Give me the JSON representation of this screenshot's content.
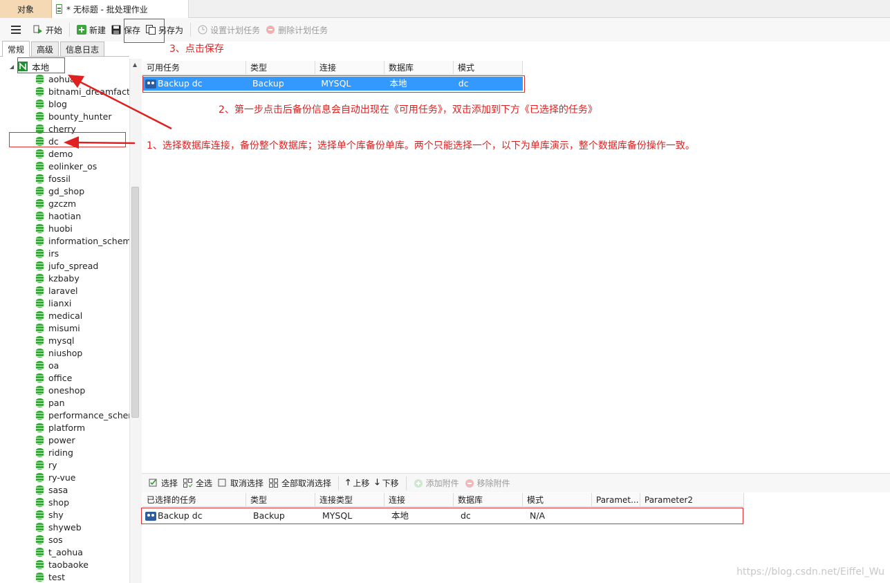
{
  "tabs": {
    "objects": "对象",
    "document": "* 无标题 - 批处理作业"
  },
  "toolbar": {
    "start": "开始",
    "new": "新建",
    "save": "保存",
    "save_as": "另存为",
    "set_schedule": "设置计划任务",
    "delete_schedule": "删除计划任务"
  },
  "left_tabs": [
    "常规",
    "高级",
    "信息日志"
  ],
  "tree": {
    "root": "本地",
    "databases": [
      "aohua",
      "bitnami_dreamfacto",
      "blog",
      "bounty_hunter",
      "cherry",
      "dc",
      "demo",
      "eolinker_os",
      "fossil",
      "gd_shop",
      "gzczm",
      "haotian",
      "huobi",
      "information_schema",
      "irs",
      "jufo_spread",
      "kzbaby",
      "laravel",
      "lianxi",
      "medical",
      "misumi",
      "mysql",
      "niushop",
      "oa",
      "office",
      "oneshop",
      "pan",
      "performance_schem",
      "platform",
      "power",
      "riding",
      "ry",
      "ry-vue",
      "sasa",
      "shop",
      "shy",
      "shyweb",
      "sos",
      "t_aohua",
      "taobaoke",
      "test"
    ]
  },
  "available": {
    "headers": [
      "可用任务",
      "类型",
      "连接",
      "数据库",
      "模式"
    ],
    "rows": [
      [
        "Backup dc",
        "Backup",
        "MYSQL",
        "本地",
        "dc"
      ]
    ]
  },
  "midbar": {
    "select": "选择",
    "select_all": "全选",
    "deselect": "取消选择",
    "deselect_all": "全部取消选择",
    "move_up": "上移",
    "move_down": "下移",
    "add_attachment": "添加附件",
    "remove_attachment": "移除附件"
  },
  "selected": {
    "headers": [
      "已选择的任务",
      "类型",
      "连接类型",
      "连接",
      "数据库",
      "模式",
      "Paramet...",
      "Parameter2"
    ],
    "rows": [
      [
        "Backup dc",
        "Backup",
        "MYSQL",
        "本地",
        "dc",
        "N/A",
        "",
        ""
      ]
    ]
  },
  "annotations": {
    "a1": "1、选择数据库连接，备份整个数据库；选择单个库备份单库。两个只能选择一个，以下为单库演示，整个数据库备份操作一致。",
    "a2": "2、第一步点击后备份信息会自动出现在《可用任务》，双击添加到下方《已选择的任务》",
    "a3": "3、点击保存"
  },
  "watermark": "https://blog.csdn.net/Eiffel_Wu",
  "colors": {
    "selection": "#3399ff",
    "annotation": "#e02020",
    "db_icon": "#3aa53a"
  }
}
